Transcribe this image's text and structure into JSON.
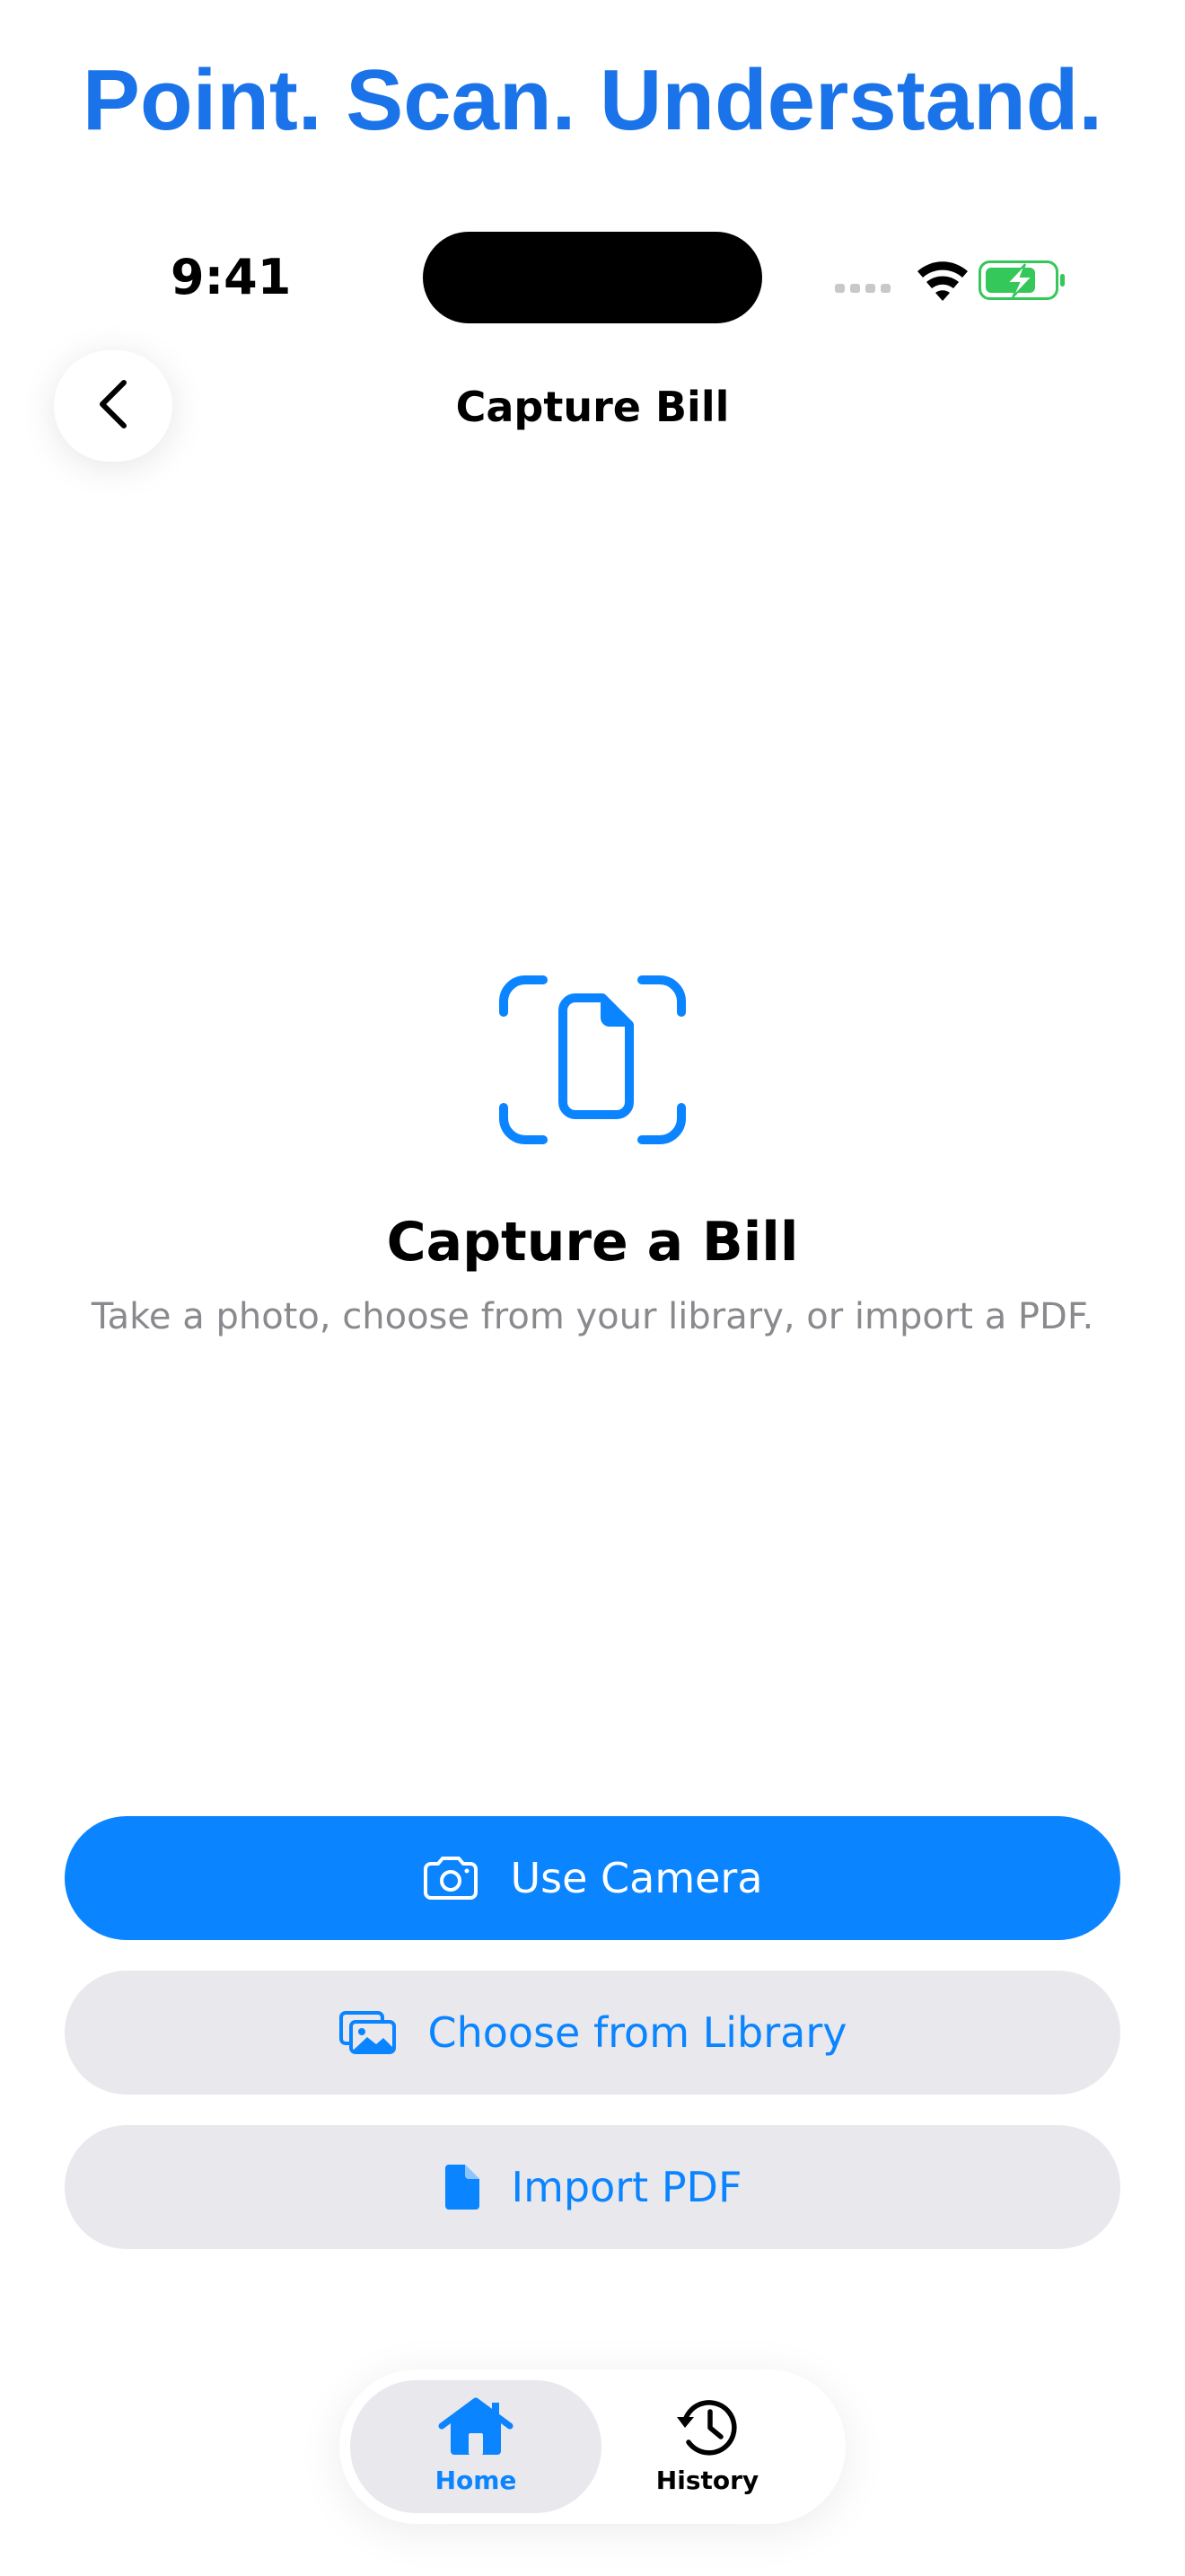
{
  "headline": "Point. Scan. Understand.",
  "status_bar": {
    "time": "9:41",
    "icons": [
      "signal-icon",
      "wifi-icon",
      "battery-charging-icon"
    ]
  },
  "nav": {
    "back_icon": "chevron-left-icon",
    "title": "Capture Bill"
  },
  "hero": {
    "icon": "document-scan-icon",
    "title": "Capture a Bill",
    "subtitle": "Take a photo, choose from your library, or import a PDF."
  },
  "actions": {
    "camera": {
      "label": "Use Camera",
      "icon": "camera-icon"
    },
    "library": {
      "label": "Choose from Library",
      "icon": "photo-library-icon"
    },
    "pdf": {
      "label": "Import PDF",
      "icon": "document-icon"
    }
  },
  "tabbar": {
    "tabs": [
      {
        "label": "Home",
        "icon": "house-icon",
        "selected": true
      },
      {
        "label": "History",
        "icon": "clock-history-icon",
        "selected": false
      }
    ]
  },
  "colors": {
    "accent": "#0a84ff",
    "headline": "#1a73e8",
    "secondary_button_bg": "#e8e8ed",
    "subtitle": "#8a8a8e",
    "battery": "#34c759"
  }
}
